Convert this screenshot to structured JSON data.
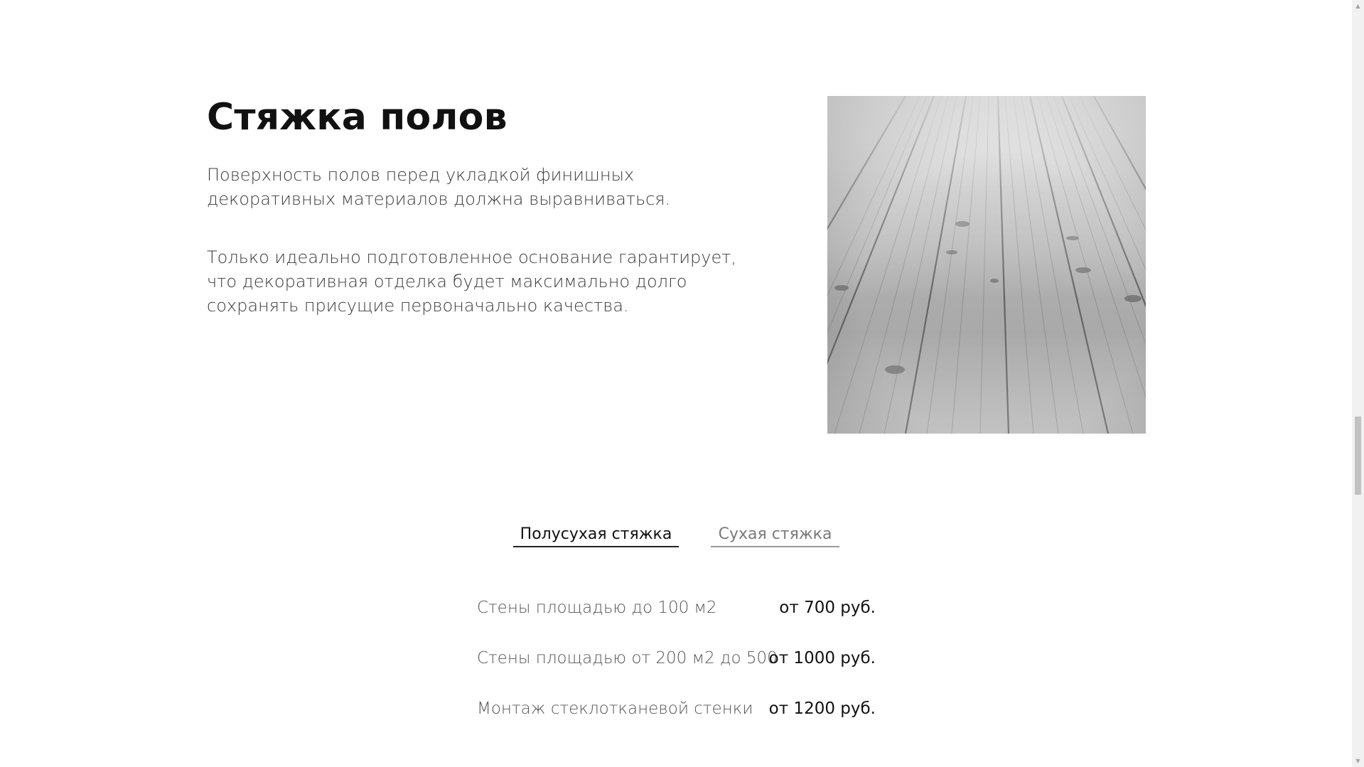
{
  "section": {
    "title": "Стяжка полов",
    "paragraphs": [
      "Поверхность полов перед укладкой финишных декоративных материалов должна выравниваться.",
      "Только идеально подготовленное основание гарантирует, что декоративная отделка будет максимально долго сохранять присущие первоначально качества."
    ]
  },
  "tabs": [
    {
      "label": "Полусухая стяжка",
      "active": true
    },
    {
      "label": "Сухая стяжка",
      "active": false
    }
  ],
  "prices": [
    {
      "name": "Стены площадью до 100 м2",
      "value": "от 700 руб."
    },
    {
      "name": "Стены площадью от 200 м2 до 500",
      "value": "от 1000 руб."
    },
    {
      "name": "Монтаж стеклотканевой стенки",
      "value": "от 1200 руб."
    }
  ],
  "scrollbar": {
    "up_icon": "triangle-up",
    "down_icon": "triangle-down"
  },
  "colors": {
    "background": "#ffffff",
    "title": "#111111",
    "body_text": "#3a3a3a",
    "price_name": "#555555",
    "tab_active": "#111111",
    "tab_inactive": "#7a7a7a"
  }
}
